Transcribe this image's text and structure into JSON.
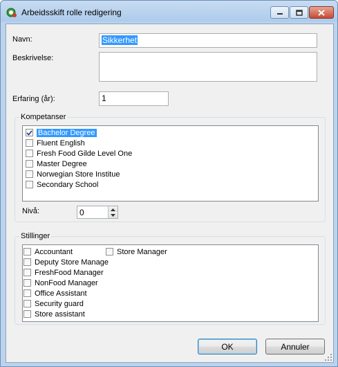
{
  "window": {
    "title": "Arbeidsskift rolle redigering"
  },
  "form": {
    "navn_label": "Navn:",
    "navn_value": "Sikkerhet",
    "beskrivelse_label": "Beskrivelse:",
    "beskrivelse_value": "",
    "erfaring_label": "Erfaring (år):",
    "erfaring_value": "1"
  },
  "kompetanser": {
    "title": "Kompetanser",
    "items": [
      {
        "label": "Bachelor Degree",
        "checked": true,
        "selected": true
      },
      {
        "label": "Fluent English",
        "checked": false,
        "selected": false
      },
      {
        "label": "Fresh Food Gilde Level One",
        "checked": false,
        "selected": false
      },
      {
        "label": "Master Degree",
        "checked": false,
        "selected": false
      },
      {
        "label": "Norwegian Store Institue",
        "checked": false,
        "selected": false
      },
      {
        "label": "Secondary School",
        "checked": false,
        "selected": false
      }
    ],
    "niva_label": "Nivå:",
    "niva_value": "0"
  },
  "stillinger": {
    "title": "Stillinger",
    "column1": [
      {
        "label": "Accountant",
        "checked": false
      },
      {
        "label": "Deputy Store Manage",
        "checked": false
      },
      {
        "label": "FreshFood Manager",
        "checked": false
      },
      {
        "label": "NonFood Manager",
        "checked": false
      },
      {
        "label": "Office Assistant",
        "checked": false
      },
      {
        "label": "Security guard",
        "checked": false
      },
      {
        "label": "Store assistant",
        "checked": false
      }
    ],
    "column2": [
      {
        "label": "Store Manager",
        "checked": false
      }
    ]
  },
  "buttons": {
    "ok": "OK",
    "cancel": "Annuler"
  }
}
